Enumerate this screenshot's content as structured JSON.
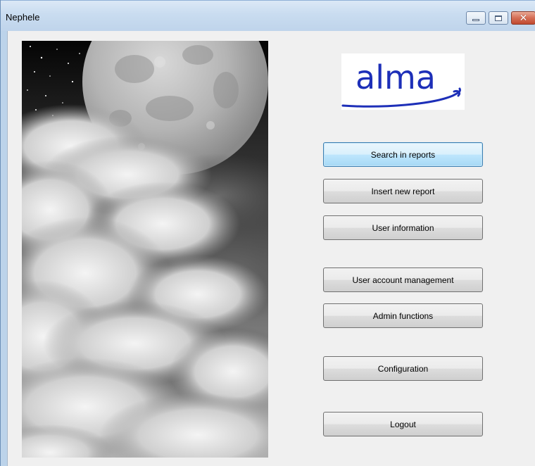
{
  "window": {
    "title": "Nephele"
  },
  "logo": {
    "text": "alma"
  },
  "buttons": {
    "search_reports": "Search in reports",
    "insert_report": "Insert new report",
    "user_information": "User information",
    "user_account_management": "User account management",
    "admin_functions": "Admin functions",
    "configuration": "Configuration",
    "logout": "Logout"
  },
  "colors": {
    "logo_blue": "#1d2fb8",
    "focus_border": "#3c7fb1",
    "client_bg": "#f0f0f0",
    "close_red": "#c04a30"
  },
  "icons": {
    "minimize": "minimize-icon",
    "maximize": "maximize-icon",
    "close": "close-icon"
  }
}
